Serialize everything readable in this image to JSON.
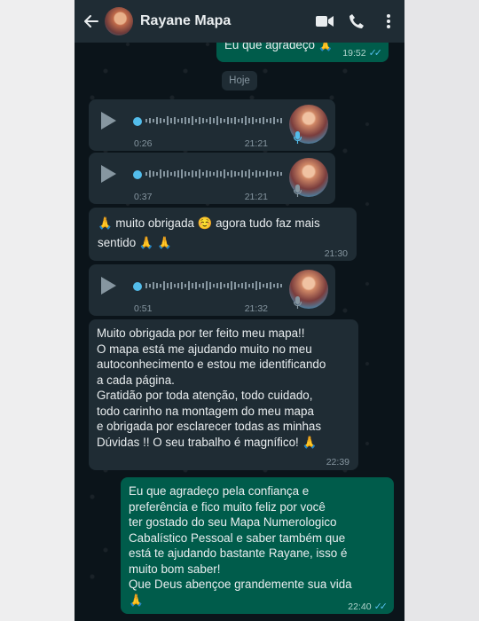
{
  "header": {
    "contact_name": "Rayane Mapa",
    "back_icon": "arrow-left",
    "icons": [
      "video-camera",
      "phone",
      "more-vert"
    ]
  },
  "messages": {
    "prev_out": {
      "text": "Eu que agradeço 🙏",
      "time": "19:52"
    },
    "date_chip": "Hoje",
    "voice1": {
      "duration": "0:26",
      "time": "21:21"
    },
    "voice2": {
      "duration": "0:37",
      "time": "21:21"
    },
    "text1": {
      "text": "🙏 muito obrigada ☺️ agora tudo faz mais\nsentido 🙏 🙏",
      "time": "21:30"
    },
    "voice3": {
      "duration": "0:51",
      "time": "21:32"
    },
    "text2": {
      "text": "Muito obrigada por ter feito meu mapa!!\nO mapa está me ajudando muito no meu\nautoconhecimento e estou me identificando\na cada página.\nGratidão por toda atenção, todo cuidado,\ntodo carinho na montagem do meu mapa\ne obrigada por esclarecer todas as minhas\nDúvidas !! O seu trabalho é magnífico! 🙏",
      "time": "22:39"
    },
    "reply": {
      "text": "Eu que agradeço pela confiança e\npreferência e fico muito feliz por você\nter gostado do seu Mapa Numerologico\nCabalístico Pessoal e saber também que\nestá te ajudando bastante Rayane, isso é\nmuito bom saber!\nQue Deus abençoe grandemente sua vida\n🙏",
      "time": "22:40"
    }
  },
  "colors": {
    "header": "#1f2c34",
    "incoming": "#1f2c34",
    "outgoing": "#005c4b",
    "background": "#0b141a",
    "tick": "#53bdeb"
  }
}
